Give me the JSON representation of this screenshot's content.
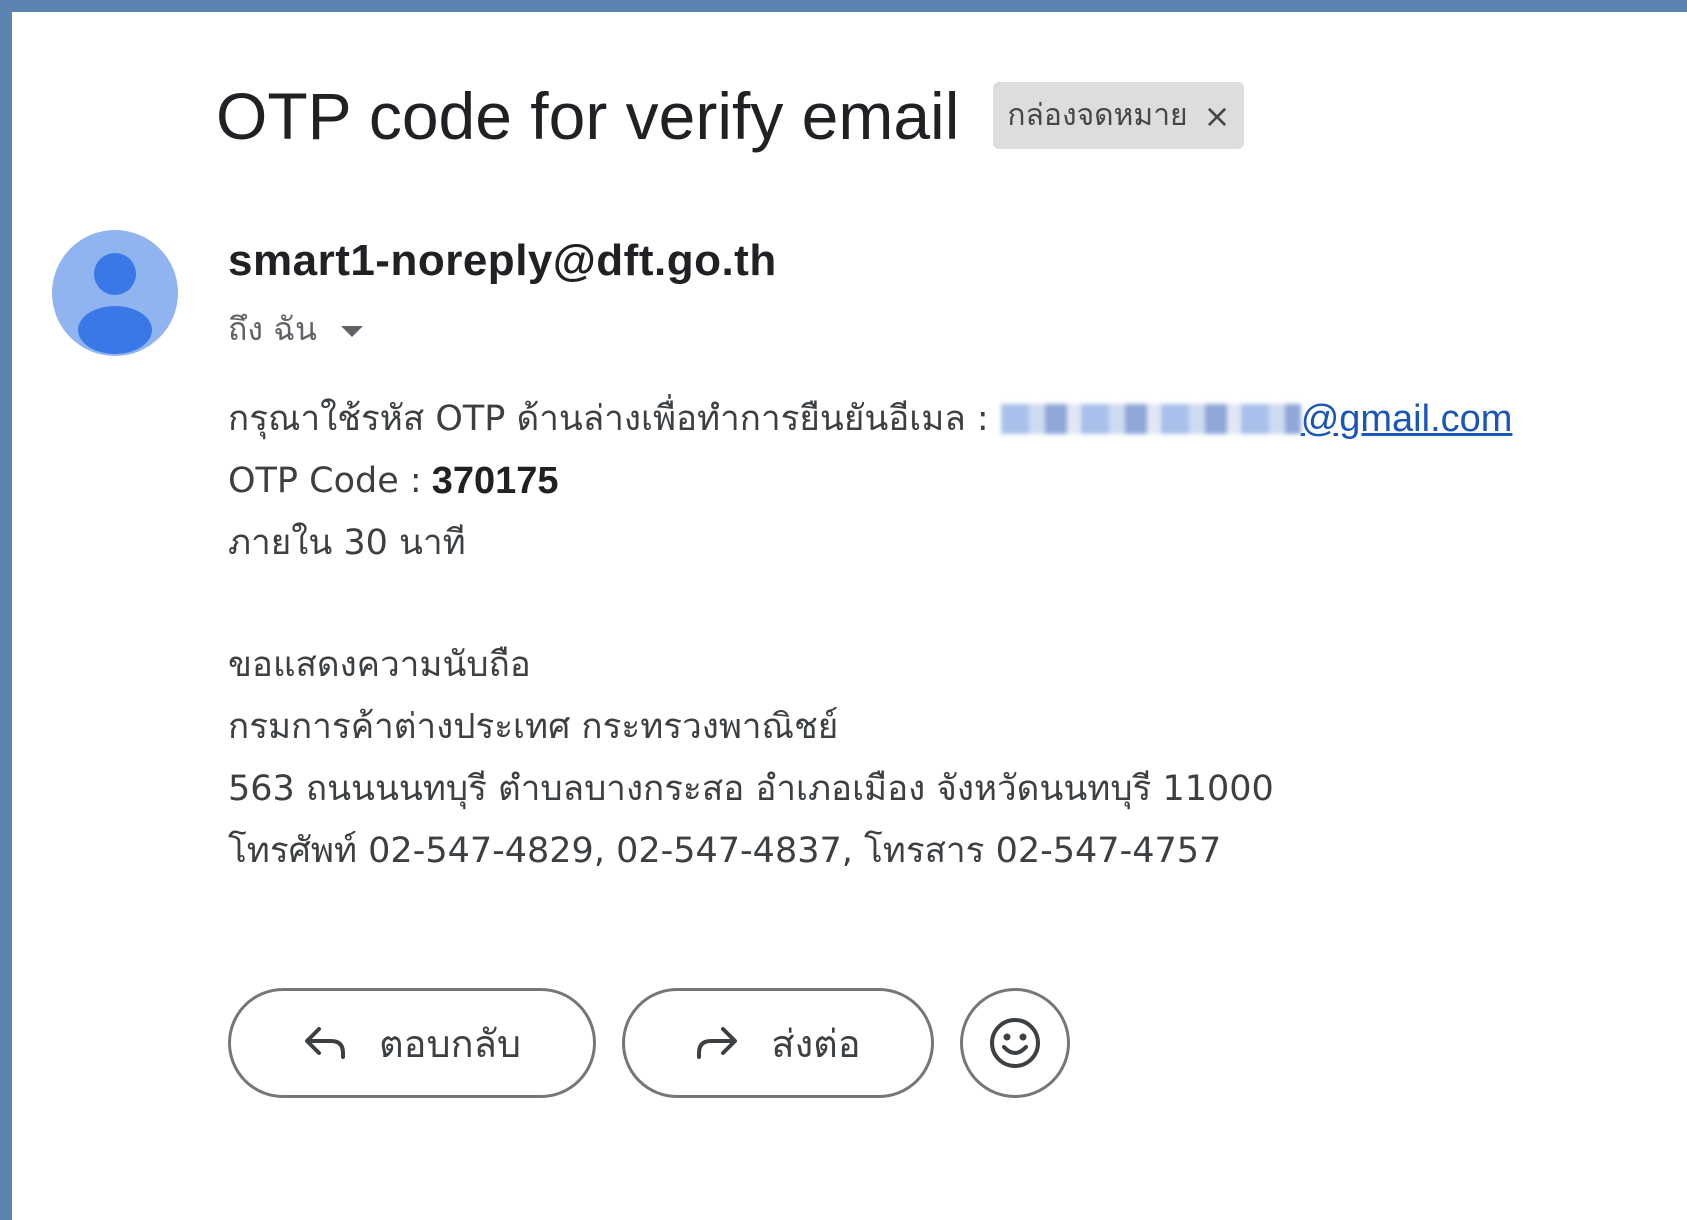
{
  "subject": "OTP code for verify email",
  "label_chip": {
    "text": "กล่องจดหมาย",
    "close": "×"
  },
  "sender": {
    "email": "smart1-noreply@dft.go.th",
    "to_label": "ถึง ฉัน"
  },
  "body": {
    "line1_prefix": "กรุณาใช้รหัส OTP ด้านล่างเพื่อทำการยืนยันอีเมล :",
    "email_domain": "@gmail.com",
    "otp_label": "OTP Code :",
    "otp_value": "370175",
    "expiry": "ภายใน 30 นาที",
    "sign_off": "ขอแสดงความนับถือ",
    "org": "กรมการค้าต่างประเทศ กระทรวงพาณิชย์",
    "address": "563 ถนนนนทบุรี ตำบลบางกระสอ อำเภอเมือง จังหวัดนนทบุรี 11000",
    "phone": "โทรศัพท์ 02-547-4829, 02-547-4837, โทรสาร 02-547-4757"
  },
  "actions": {
    "reply_label": "ตอบกลับ",
    "forward_label": "ส่งต่อ"
  },
  "colors": {
    "frame_border": "#5b85b0",
    "avatar_bg": "#8fb4ef",
    "avatar_fg": "#3b78e7",
    "link": "#1a55b8",
    "chip_bg": "#dddddd"
  },
  "icons": {
    "avatar": "person-icon",
    "to_dropdown": "chevron-down-icon",
    "reply": "reply-arrow-icon",
    "forward": "forward-arrow-icon",
    "emoji": "smiley-icon",
    "chip_close": "close-icon"
  }
}
